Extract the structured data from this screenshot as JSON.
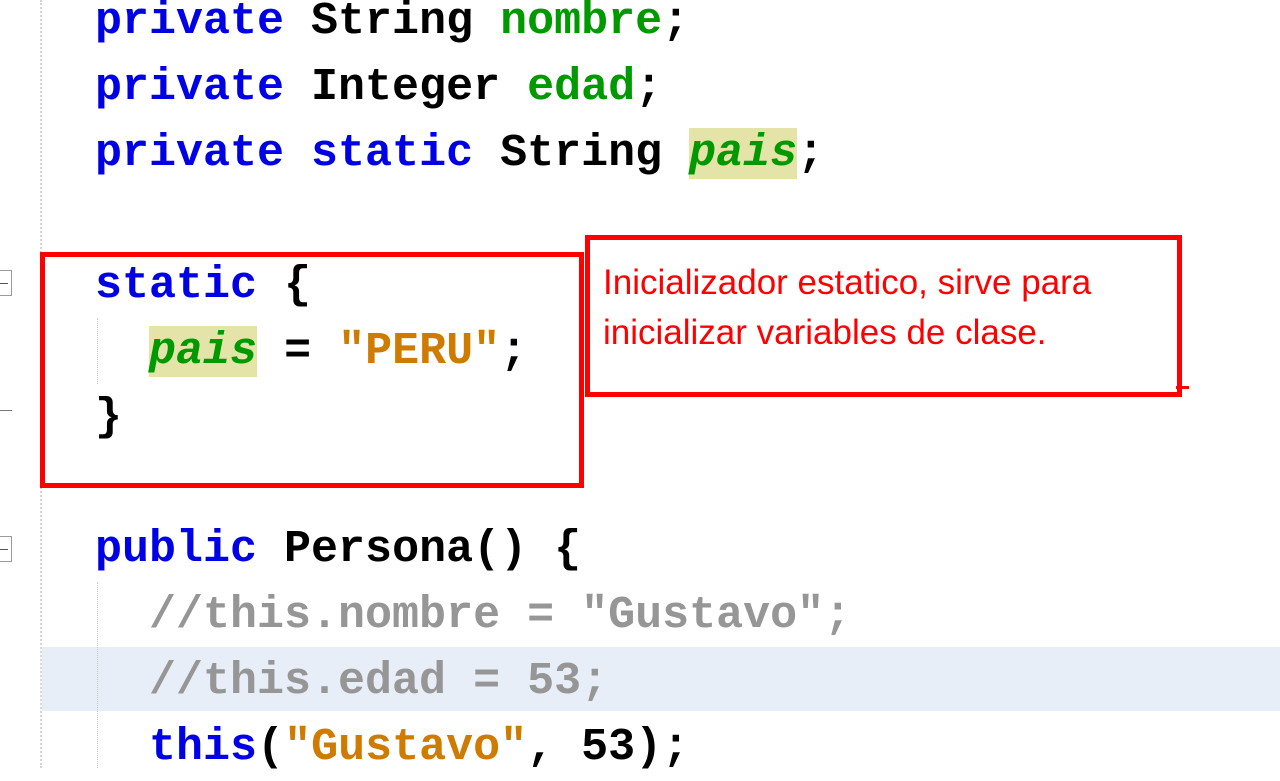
{
  "code": {
    "line1": {
      "kw1": "private",
      "type": "String",
      "name": "nombre",
      "end": ";"
    },
    "line2": {
      "kw1": "private",
      "type": "Integer",
      "name": "edad",
      "end": ";"
    },
    "line3": {
      "kw1": "private",
      "kw2": "static",
      "type": "String",
      "name": "pais",
      "end": ";"
    },
    "line4": {
      "kw": "static",
      "brace": "{"
    },
    "line5": {
      "name": "pais",
      "op": "=",
      "value": "\"PERU\"",
      "end": ";"
    },
    "line6": {
      "brace": "}"
    },
    "line7": {
      "kw": "public",
      "name": "Persona",
      "rest": "()",
      "brace": "{"
    },
    "line8": {
      "comment": "//this.nombre = \"Gustavo\";"
    },
    "line9": {
      "comment": "//this.edad = 53;"
    },
    "line10": {
      "kw": "this",
      "open": "(",
      "arg1": "\"Gustavo\"",
      "sep": ",",
      "arg2": "53",
      "close": ");"
    }
  },
  "annotation": {
    "line1": "Inicializador estatico, sirve para",
    "line2": "inicializar variables de clase."
  },
  "colors": {
    "keyword": "#0000e6",
    "field": "#009900",
    "string": "#ce7b00",
    "comment": "#969696",
    "static_highlight": "#e4e4a8",
    "current_line": "#e8eef7",
    "annotation": "#ff0000"
  },
  "icons": [
    "fold-collapse-icon",
    "fold-end-icon"
  ]
}
